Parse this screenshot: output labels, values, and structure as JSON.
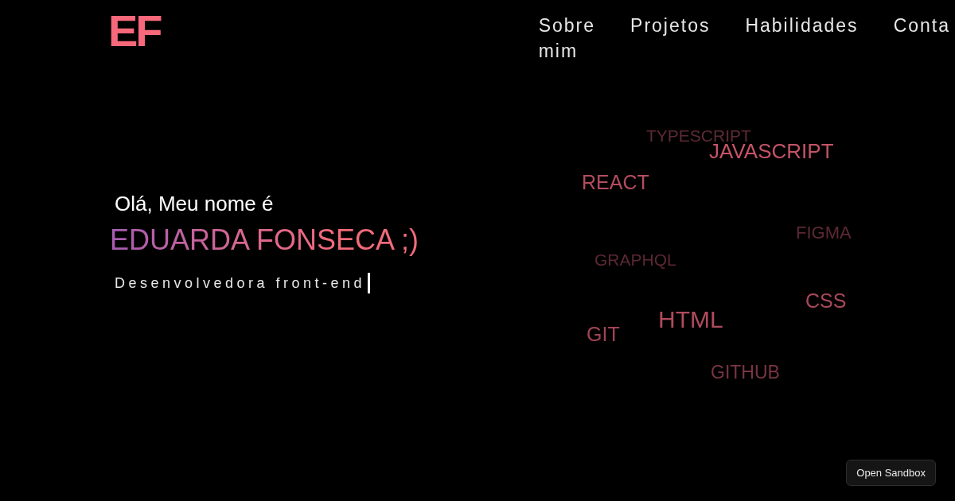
{
  "logo": "EF",
  "nav": [
    "Sobre mim",
    "Projetos",
    "Habilidades",
    "Conta"
  ],
  "hero": {
    "greeting": "Olá, Meu nome é",
    "name": "EDUARDA FONSECA ;)",
    "tagline": "Desenvolvedora front-end",
    "cursor_visible": true
  },
  "skills": [
    {
      "label": "TYPESCRIPT",
      "color": "#5e2a36"
    },
    {
      "label": "JAVASCRIPT",
      "color": "#c55467"
    },
    {
      "label": "REACT",
      "color": "#b44d5f"
    },
    {
      "label": "FIGMA",
      "color": "#5c2934"
    },
    {
      "label": "GRAPHQL",
      "color": "#5a2833"
    },
    {
      "label": "CSS",
      "color": "#a84859"
    },
    {
      "label": "HTML",
      "color": "#b04b5d"
    },
    {
      "label": "GIT",
      "color": "#a24455"
    },
    {
      "label": "GITHUB",
      "color": "#7a3543"
    }
  ],
  "sandbox_button": "Open Sandbox"
}
